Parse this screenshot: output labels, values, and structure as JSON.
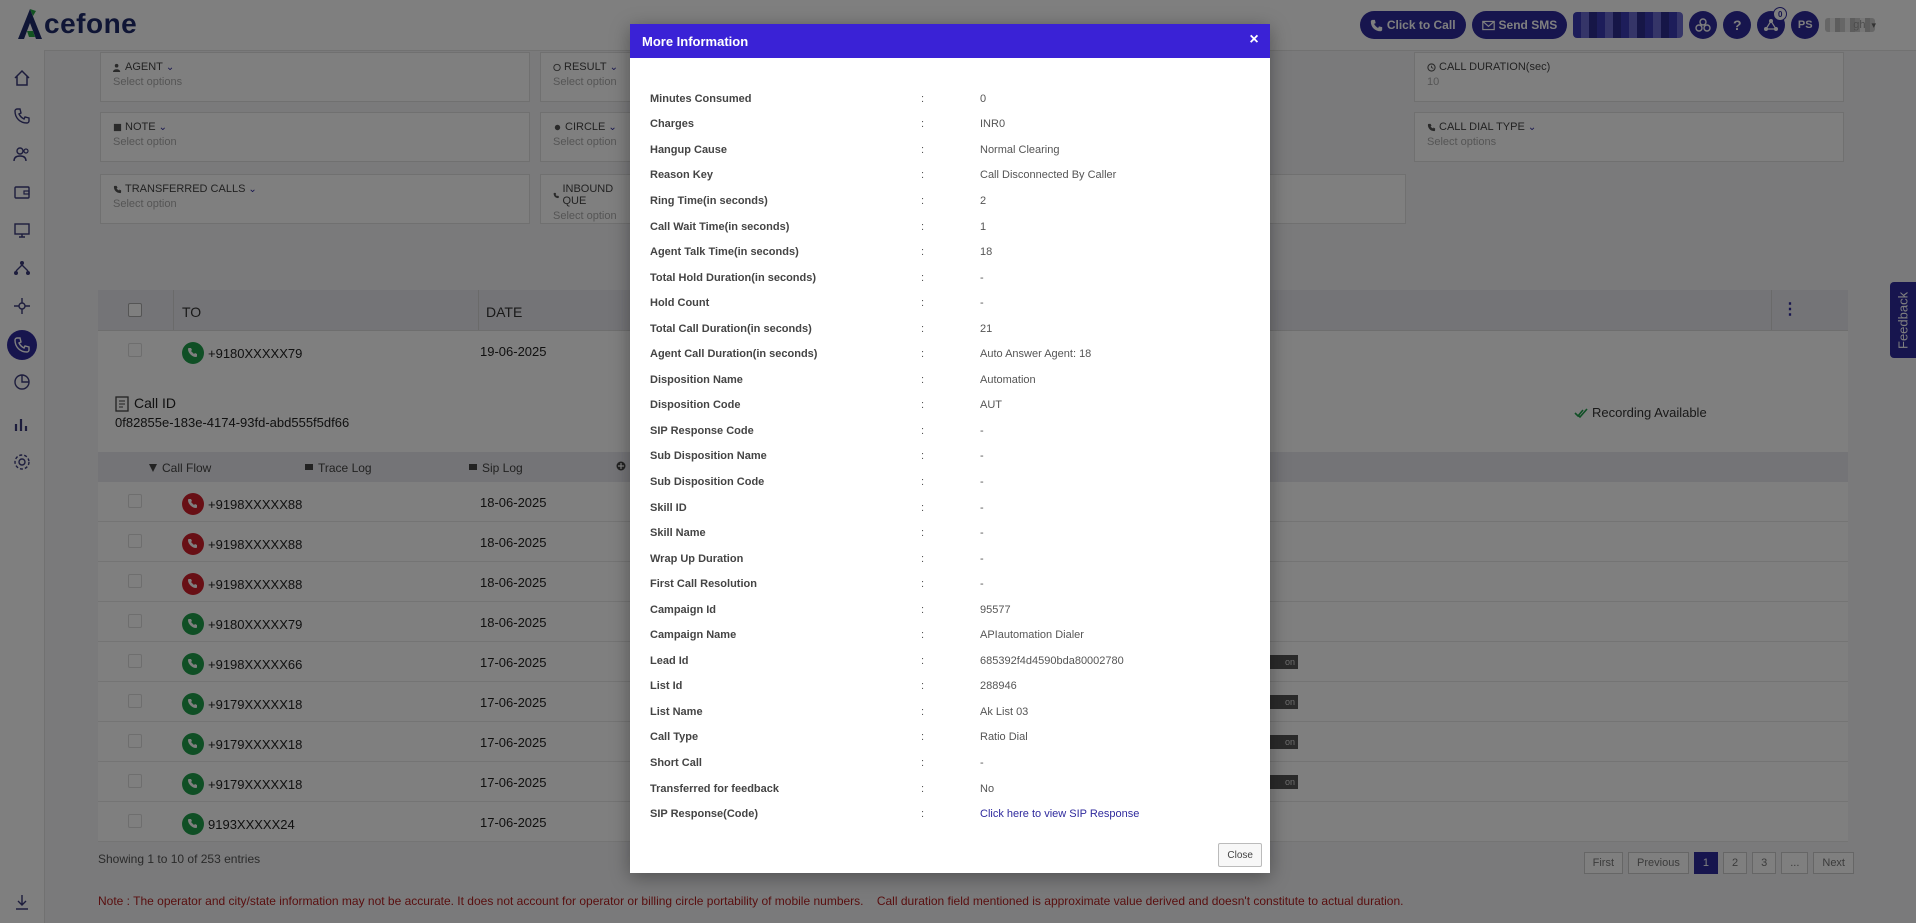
{
  "brand": {
    "logo_text": "cefone"
  },
  "topbar": {
    "click_to_call": "Click to Call",
    "send_sms": "Send SMS",
    "help": "?",
    "notification_count": "0",
    "avatar_initials": "PS",
    "user_name_suffix": "gh"
  },
  "filters": {
    "agent": {
      "label": "AGENT",
      "placeholder": "Select options"
    },
    "result": {
      "label": "RESULT",
      "placeholder": "Select option"
    },
    "call_duration": {
      "label": "CALL DURATION(sec)",
      "value": "10"
    },
    "note": {
      "label": "NOTE",
      "placeholder": "Select option"
    },
    "circle": {
      "label": "CIRCLE",
      "placeholder": "Select option"
    },
    "call_dial_type": {
      "label": "CALL DIAL TYPE",
      "placeholder": "Select options"
    },
    "transferred_calls": {
      "label": "TRANSFERRED CALLS",
      "placeholder": "Select option"
    },
    "inbound_queue": {
      "label": "INBOUND QUE",
      "placeholder": "Select option"
    }
  },
  "table": {
    "headers": {
      "to": "TO",
      "date": "DATE"
    },
    "first_row": {
      "to": "+9180XXXXX79",
      "date": "19-06-2025"
    },
    "detail": {
      "call_id_label": "Call ID",
      "call_id": "0f82855e-183e-4174-93fd-abd555f5df66",
      "recording": "Recording Available"
    },
    "subtabs": {
      "call_flow": "Call Flow",
      "trace_log": "Trace Log",
      "sip_log": "Sip Log"
    },
    "rows": [
      {
        "to": "+9198XXXXX88",
        "date": "18-06-2025",
        "status": "missed"
      },
      {
        "to": "+9198XXXXX88",
        "date": "18-06-2025",
        "status": "missed"
      },
      {
        "to": "+9198XXXXX88",
        "date": "18-06-2025",
        "status": "missed"
      },
      {
        "to": "+9180XXXXX79",
        "date": "18-06-2025",
        "status": "answered"
      },
      {
        "to": "+9198XXXXX66",
        "date": "17-06-2025",
        "status": "answered",
        "tag": "on"
      },
      {
        "to": "+9179XXXXX18",
        "date": "17-06-2025",
        "status": "answered",
        "tag": "on"
      },
      {
        "to": "+9179XXXXX18",
        "date": "17-06-2025",
        "status": "answered",
        "tag": "on"
      },
      {
        "to": "+9179XXXXX18",
        "date": "17-06-2025",
        "status": "answered",
        "tag": "on"
      },
      {
        "to": "9193XXXXX24",
        "date": "17-06-2025",
        "status": "answered"
      }
    ],
    "showing": "Showing 1 to 10 of 253 entries"
  },
  "pagination": {
    "first": "First",
    "previous": "Previous",
    "pages": [
      "1",
      "2",
      "3"
    ],
    "ellipsis": "...",
    "next": "Next"
  },
  "footer_note": "Note : The operator and city/state information may not be accurate. It does not account for operator or billing circle portability of mobile numbers.    Call duration field mentioned is approximate value derived and doesn't constitute to actual duration.",
  "feedback": "Feedback",
  "modal": {
    "title": "More Information",
    "close_x": "×",
    "close_button": "Close",
    "colon": ":",
    "rows": [
      {
        "label": "Minutes Consumed",
        "value": "0"
      },
      {
        "label": "Charges",
        "value": "INR0"
      },
      {
        "label": "Hangup Cause",
        "value": "Normal Clearing"
      },
      {
        "label": "Reason Key",
        "value": "Call Disconnected By Caller"
      },
      {
        "label": "Ring Time(in seconds)",
        "value": "2"
      },
      {
        "label": "Call Wait Time(in seconds)",
        "value": "1"
      },
      {
        "label": "Agent Talk Time(in seconds)",
        "value": "18"
      },
      {
        "label": "Total Hold Duration(in seconds)",
        "value": "-"
      },
      {
        "label": "Hold Count",
        "value": "-"
      },
      {
        "label": "Total Call Duration(in seconds)",
        "value": "21"
      },
      {
        "label": "Agent Call Duration(in seconds)",
        "value": "Auto Answer Agent: 18"
      },
      {
        "label": "Disposition Name",
        "value": "Automation"
      },
      {
        "label": "Disposition Code",
        "value": "AUT"
      },
      {
        "label": "SIP Response Code",
        "value": "-"
      },
      {
        "label": "Sub Disposition Name",
        "value": "-"
      },
      {
        "label": "Sub Disposition Code",
        "value": "-"
      },
      {
        "label": "Skill ID",
        "value": "-"
      },
      {
        "label": "Skill Name",
        "value": "-"
      },
      {
        "label": "Wrap Up Duration",
        "value": "-"
      },
      {
        "label": "First Call Resolution",
        "value": "-"
      },
      {
        "label": "Campaign Id",
        "value": "95577"
      },
      {
        "label": "Campaign Name",
        "value": "APIautomation Dialer"
      },
      {
        "label": "Lead Id",
        "value": "685392f4d4590bda80002780"
      },
      {
        "label": "List Id",
        "value": "288946"
      },
      {
        "label": "List Name",
        "value": "Ak List 03"
      },
      {
        "label": "Call Type",
        "value": "Ratio Dial"
      },
      {
        "label": "Short Call",
        "value": "-"
      },
      {
        "label": "Transferred for feedback",
        "value": "No"
      },
      {
        "label": "SIP Response(Code)",
        "value": "Click here to view SIP Response",
        "link": true
      }
    ]
  },
  "colors": {
    "brand": "#2f2a9d",
    "modal_header": "#3a22d6",
    "answered": "#1e9e4a",
    "missed": "#d11e2b",
    "note": "#b21f1f"
  }
}
